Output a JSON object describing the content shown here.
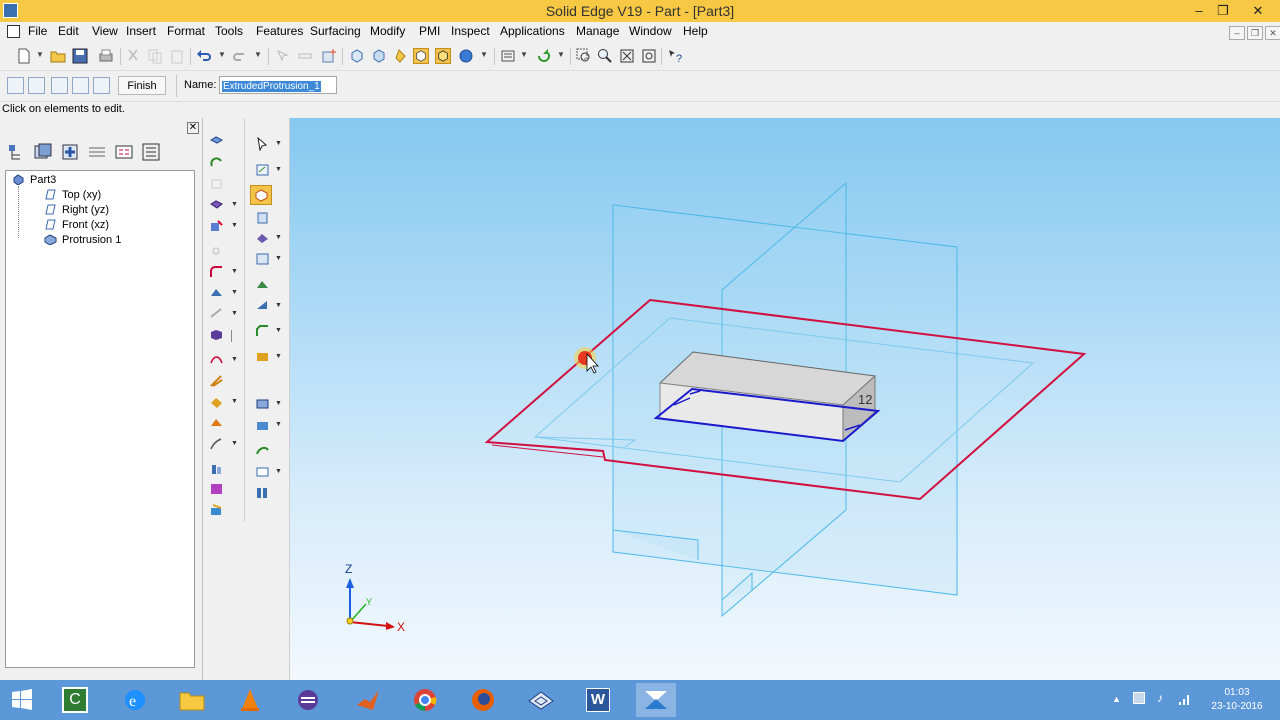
{
  "window": {
    "title": "Solid Edge V19 - Part - [Part3]",
    "minimize_glyph": "–",
    "restore_glyph": "❐",
    "close_glyph": "✕"
  },
  "menubar": {
    "items": [
      "File",
      "Edit",
      "View",
      "Insert",
      "Format",
      "Tools",
      "Features",
      "Surfacing",
      "Modify",
      "PMI",
      "Inspect",
      "Applications",
      "Manage",
      "Window",
      "Help"
    ]
  },
  "ribbon": {
    "finish_label": "Finish",
    "name_label": "Name:",
    "name_value": "ExtrudedProtrusion_1"
  },
  "prompt": "Click on elements to edit.",
  "pathfinder": {
    "close_glyph": "✕",
    "tree": [
      {
        "label": "Part3",
        "icon": "part-icon"
      },
      {
        "label": "Top (xy)",
        "icon": "plane-icon"
      },
      {
        "label": "Right (yz)",
        "icon": "plane-icon"
      },
      {
        "label": "Front (xz)",
        "icon": "plane-icon"
      },
      {
        "label": "Protrusion 1",
        "icon": "protrusion-icon"
      }
    ]
  },
  "viewport": {
    "dimension_label": "12",
    "triad": {
      "z": "Z",
      "y": "Y",
      "x": "X"
    },
    "colors": {
      "reference_plane": "#d21040",
      "sketch_profile": "#1a1acc",
      "ghost_planes": "#4db8e8",
      "triad_x": "#d21010",
      "triad_y": "#20b020",
      "triad_z": "#1a60e0"
    }
  },
  "taskbar": {
    "apps": [
      "start-icon",
      "camtasia-icon",
      "ie-icon",
      "explorer-icon",
      "vlc-icon",
      "eclipse-icon",
      "matlab-icon",
      "chrome-icon",
      "firefox-icon",
      "solid-edge-part-icon",
      "word-icon",
      "solid-edge-icon"
    ],
    "time": "01:03",
    "date": "23-10-2016"
  }
}
